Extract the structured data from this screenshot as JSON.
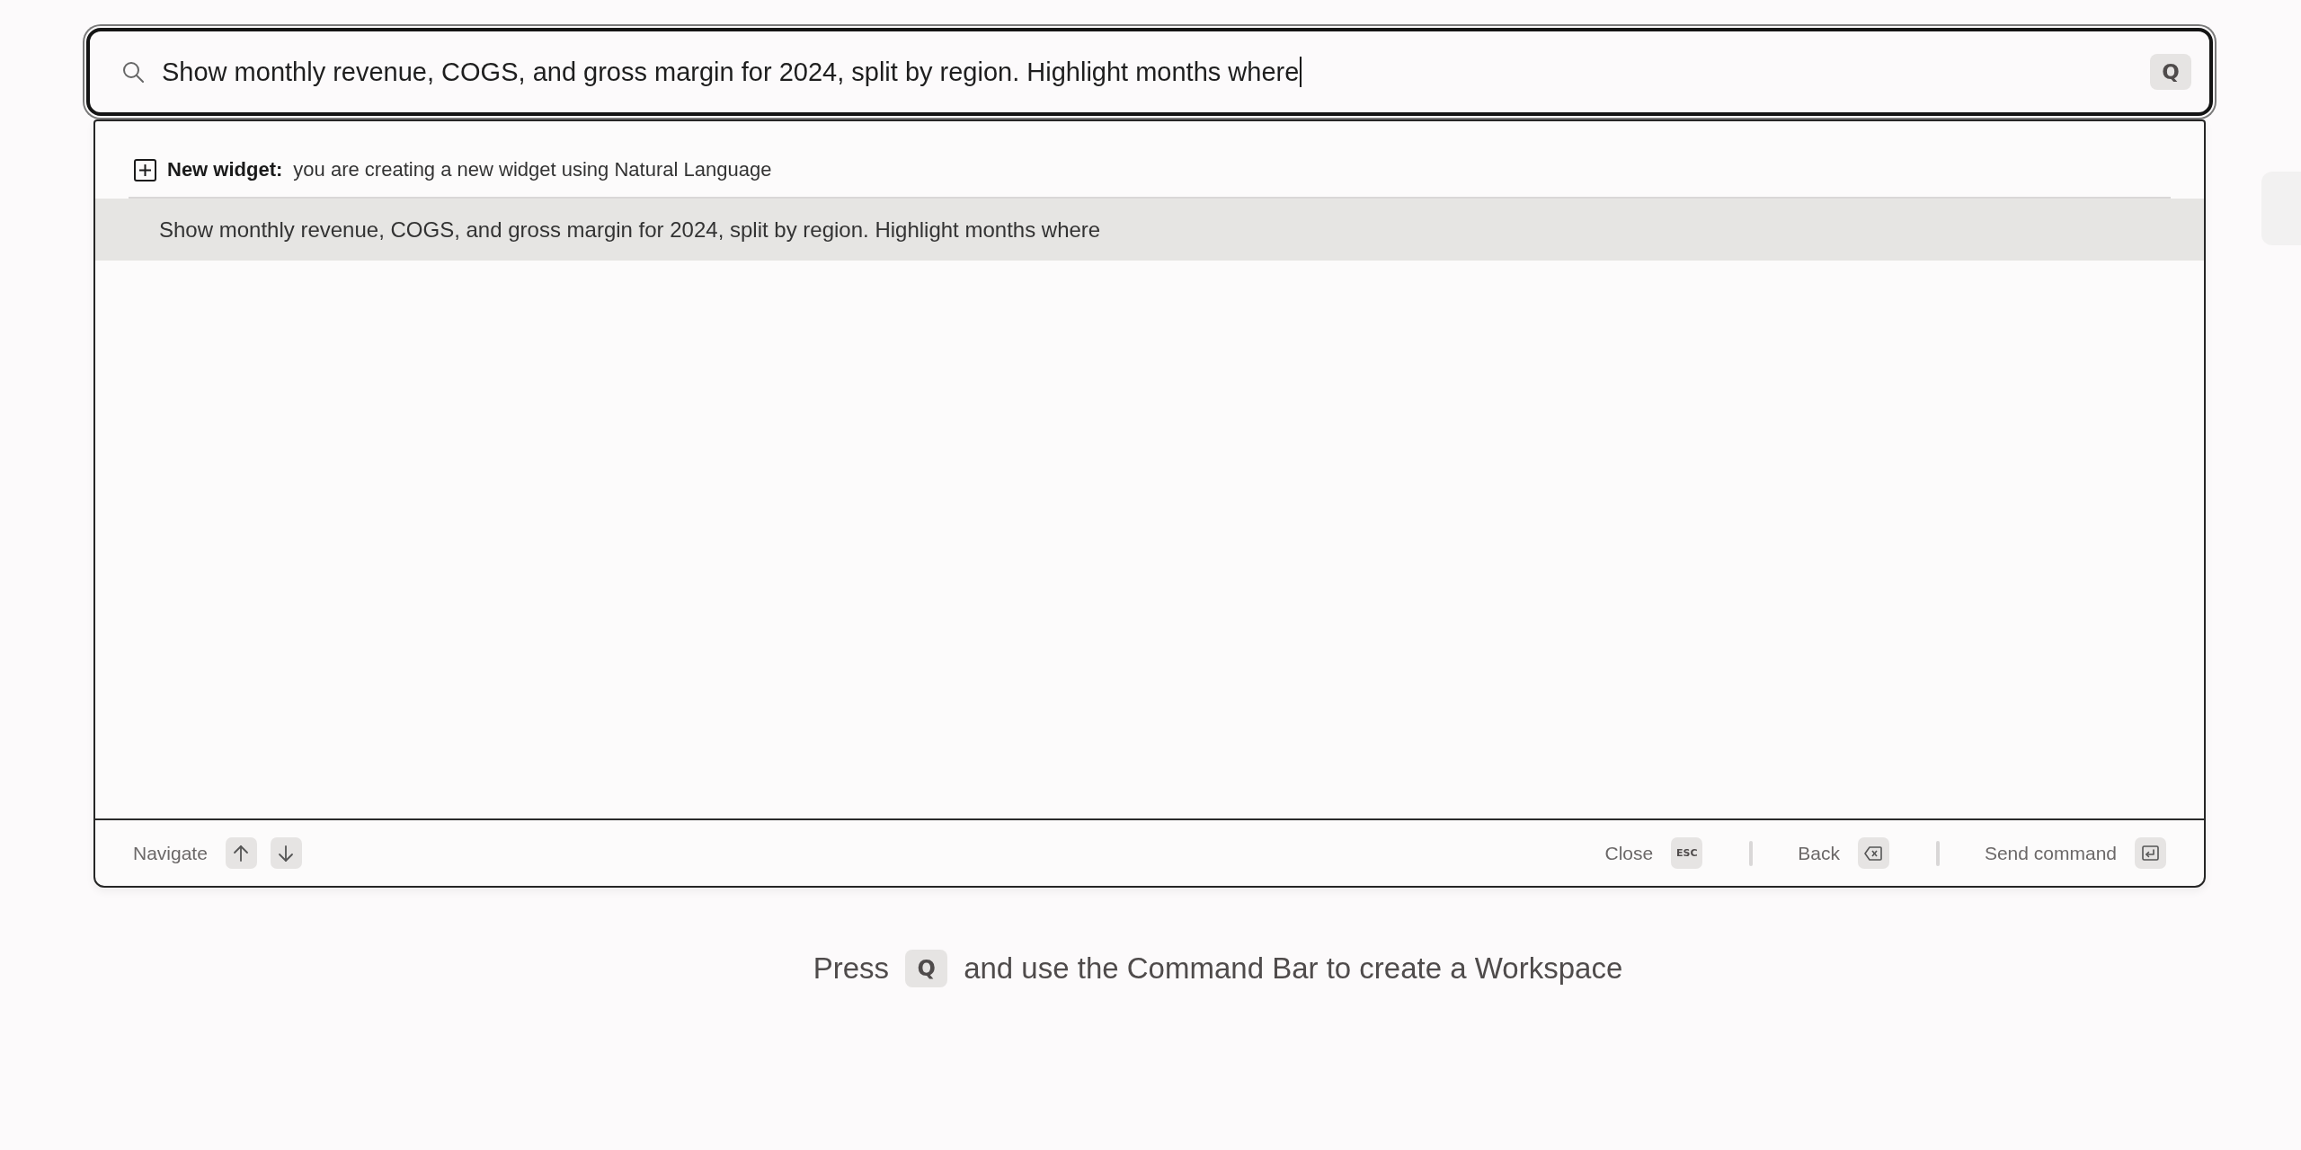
{
  "search": {
    "value": "Show monthly revenue, COGS, and gross margin for 2024, split by region. Highlight months where",
    "focused": true,
    "shortcut_key": "Q"
  },
  "dropdown": {
    "section": {
      "label": "New widget:",
      "description": "you are creating a new widget using Natural Language"
    },
    "suggestions": [
      {
        "text": "Show monthly revenue, COGS, and gross margin for 2024, split by region. Highlight months where",
        "selected": true
      }
    ]
  },
  "footer": {
    "left": [
      {
        "label": "Navigate",
        "keys": [
          {
            "kind": "up"
          },
          {
            "kind": "down"
          }
        ]
      }
    ],
    "right": [
      {
        "label": "Close",
        "keys": [
          {
            "kind": "text",
            "text": "ESC"
          }
        ]
      },
      {
        "label": "Back",
        "keys": [
          {
            "kind": "backspace"
          }
        ]
      },
      {
        "label": "Send command",
        "keys": [
          {
            "kind": "enter"
          }
        ]
      }
    ]
  },
  "hint": {
    "before": "Press",
    "key": "Q",
    "after": "and use the Command Bar to create a Workspace"
  }
}
